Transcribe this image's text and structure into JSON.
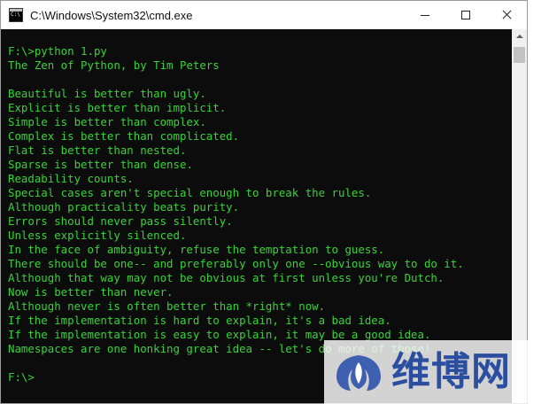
{
  "window": {
    "title": "C:\\Windows\\System32\\cmd.exe"
  },
  "icons": {
    "app": "cmd-console-icon",
    "minimize": "minimize-icon",
    "maximize": "maximize-icon",
    "close": "close-icon",
    "scroll_up": "scroll-up-arrow-icon"
  },
  "console": {
    "lines": [
      "F:\\>python 1.py",
      "The Zen of Python, by Tim Peters",
      "",
      "Beautiful is better than ugly.",
      "Explicit is better than implicit.",
      "Simple is better than complex.",
      "Complex is better than complicated.",
      "Flat is better than nested.",
      "Sparse is better than dense.",
      "Readability counts.",
      "Special cases aren't special enough to break the rules.",
      "Although practicality beats purity.",
      "Errors should never pass silently.",
      "Unless explicitly silenced.",
      "In the face of ambiguity, refuse the temptation to guess.",
      "There should be one-- and preferably only one --obvious way to do it.",
      "Although that way may not be obvious at first unless you're Dutch.",
      "Now is better than never.",
      "Although never is often better than *right* now.",
      "If the implementation is hard to explain, it's a bad idea.",
      "If the implementation is easy to explain, it may be a good idea.",
      "Namespaces are one honking great idea -- let's do more of those!",
      "",
      "F:\\>"
    ]
  },
  "watermark": {
    "text": "维博网",
    "logo": "weibo-net-logo"
  },
  "colors": {
    "console_background": "#0c0c0c",
    "console_text": "#39d339",
    "titlebar": "#ffffff",
    "watermark_blue": "#2b4ea1"
  }
}
